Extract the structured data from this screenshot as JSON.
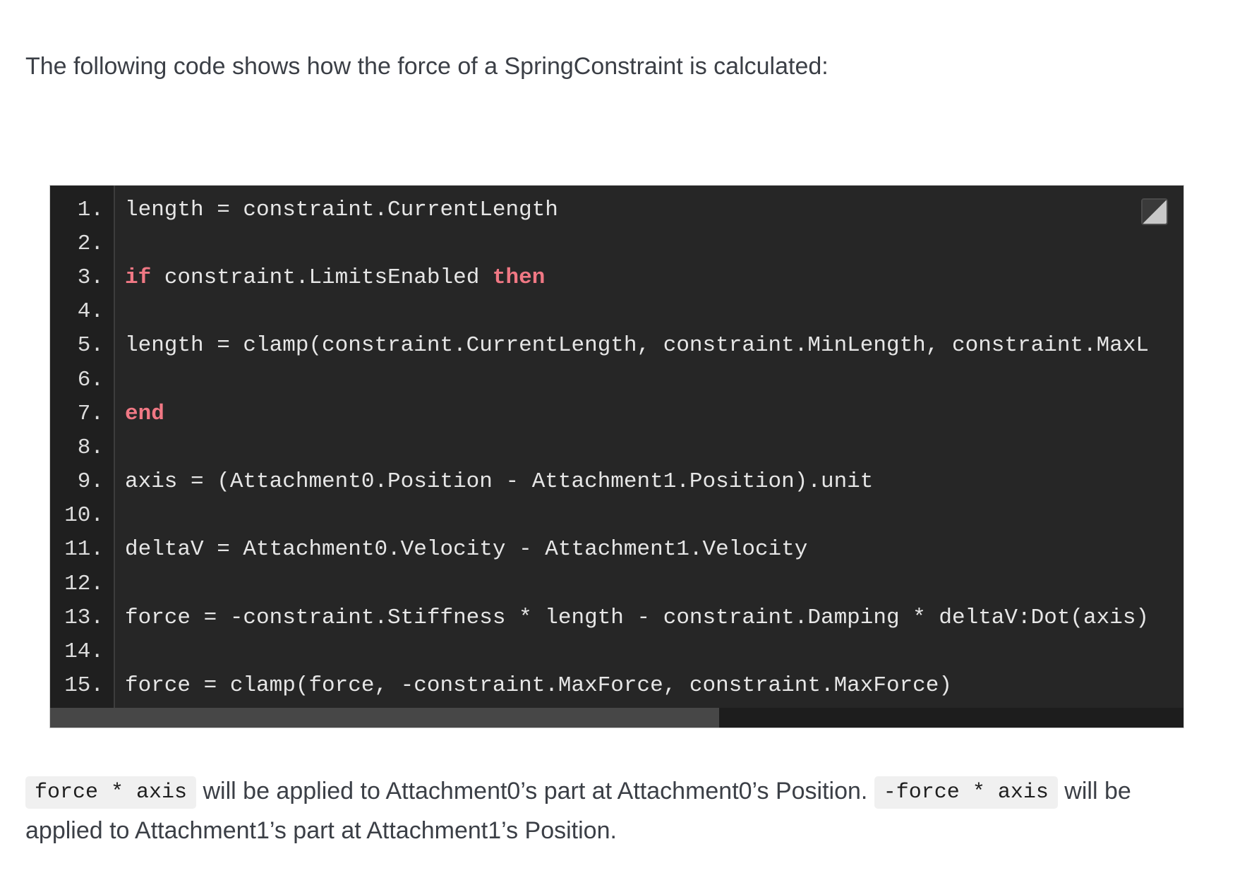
{
  "intro": {
    "text": "The following code shows how the force of a SpringConstraint is calculated:"
  },
  "code_block": {
    "expand_icon": "expand-icon",
    "scroll_position": 0.59,
    "colors": {
      "background": "#262626",
      "gutter": "#1f1f1f",
      "text": "#e6e6e6",
      "keyword": "#f07884"
    },
    "lines": [
      {
        "number": "1.",
        "segments": [
          {
            "text": "length = constraint.CurrentLength",
            "keyword": false
          }
        ]
      },
      {
        "number": "2.",
        "segments": []
      },
      {
        "number": "3.",
        "segments": [
          {
            "text": "if",
            "keyword": true
          },
          {
            "text": " constraint.LimitsEnabled ",
            "keyword": false
          },
          {
            "text": "then",
            "keyword": true
          }
        ]
      },
      {
        "number": "4.",
        "segments": []
      },
      {
        "number": "5.",
        "segments": [
          {
            "text": "length = clamp(constraint.CurrentLength, constraint.MinLength, constraint.MaxL",
            "keyword": false
          }
        ]
      },
      {
        "number": "6.",
        "segments": []
      },
      {
        "number": "7.",
        "segments": [
          {
            "text": "end",
            "keyword": true
          }
        ]
      },
      {
        "number": "8.",
        "segments": []
      },
      {
        "number": "9.",
        "segments": [
          {
            "text": "axis = (Attachment0.Position - Attachment1.Position).unit",
            "keyword": false
          }
        ]
      },
      {
        "number": "10.",
        "segments": []
      },
      {
        "number": "11.",
        "segments": [
          {
            "text": "deltaV = Attachment0.Velocity - Attachment1.Velocity",
            "keyword": false
          }
        ]
      },
      {
        "number": "12.",
        "segments": []
      },
      {
        "number": "13.",
        "segments": [
          {
            "text": "force = -constraint.Stiffness * length - constraint.Damping * deltaV:Dot(axis)",
            "keyword": false
          }
        ]
      },
      {
        "number": "14.",
        "segments": []
      },
      {
        "number": "15.",
        "segments": [
          {
            "text": "force = clamp(force, -constraint.MaxForce, constraint.MaxForce)",
            "keyword": false
          }
        ]
      }
    ]
  },
  "outro": {
    "code1": "force * axis",
    "text1": " will be applied to Attachment0’s part at Attachment0’s Position. ",
    "code2": "-force * axis",
    "text2": " will be applied to Attachment1’s part at Attachment1’s Position."
  }
}
